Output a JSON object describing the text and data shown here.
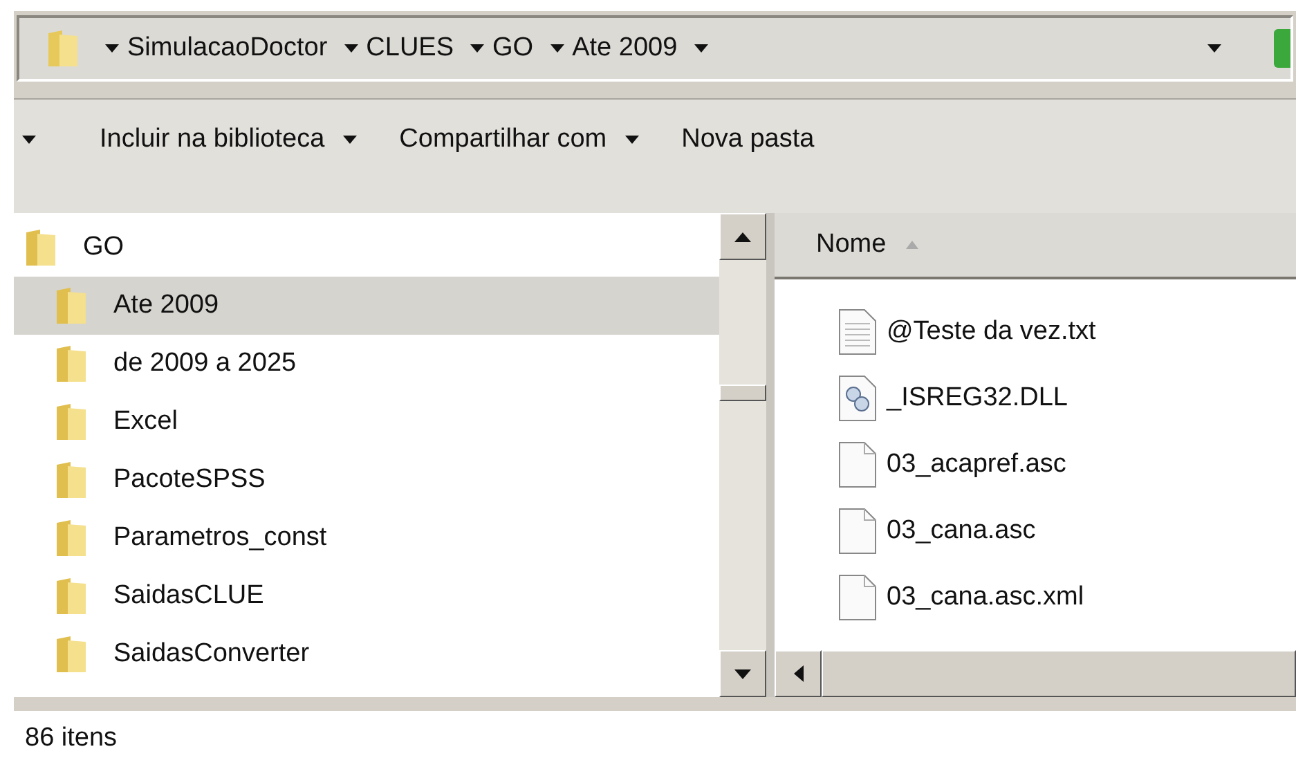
{
  "address_bar": {
    "crumbs": [
      "SimulacaoDoctor",
      "CLUES",
      "GO",
      "Ate 2009"
    ]
  },
  "toolbar": {
    "buttons": [
      {
        "label": "Incluir na biblioteca",
        "dropdown": true
      },
      {
        "label": "Compartilhar com",
        "dropdown": true
      },
      {
        "label": "Nova pasta",
        "dropdown": false
      }
    ]
  },
  "tree": {
    "items": [
      {
        "label": "GO",
        "selected": false,
        "children": [
          {
            "label": "Ate 2009",
            "selected": true
          },
          {
            "label": "de 2009 a 2025",
            "selected": false
          },
          {
            "label": "Excel",
            "selected": false
          },
          {
            "label": "PacoteSPSS",
            "selected": false
          },
          {
            "label": "Parametros_const",
            "selected": false
          },
          {
            "label": "SaidasCLUE",
            "selected": false
          },
          {
            "label": "SaidasConverter",
            "selected": false
          }
        ]
      }
    ]
  },
  "file_list": {
    "columns": [
      "Nome"
    ],
    "rows": [
      {
        "name": "@Teste da vez.txt",
        "kind": "text"
      },
      {
        "name": "_ISREG32.DLL",
        "kind": "dll"
      },
      {
        "name": "03_acapref.asc",
        "kind": "blank"
      },
      {
        "name": "03_cana.asc",
        "kind": "blank"
      },
      {
        "name": "03_cana.asc.xml",
        "kind": "blank"
      }
    ]
  },
  "status_bar": {
    "text": "86 itens"
  }
}
